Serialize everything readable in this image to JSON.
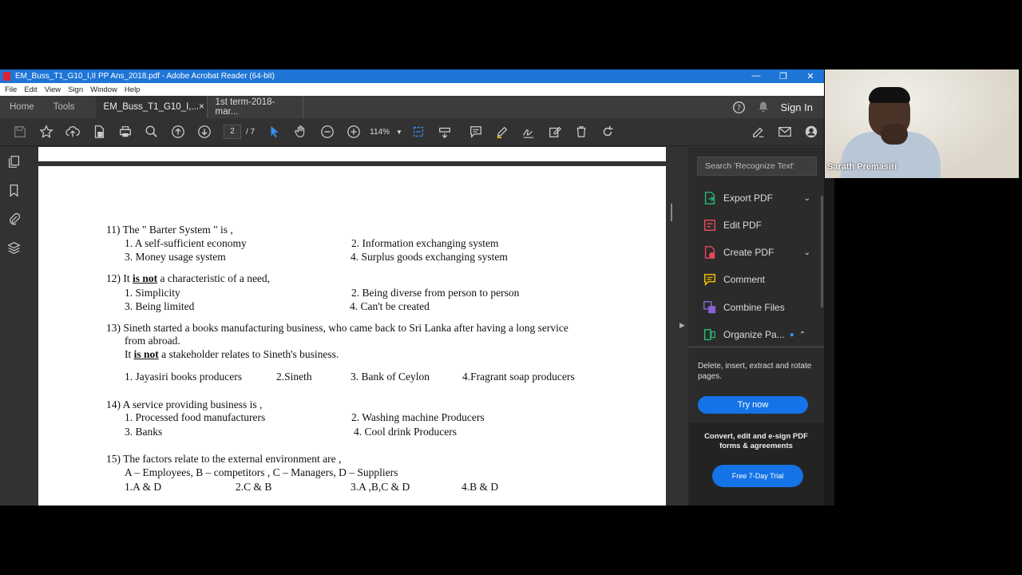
{
  "window": {
    "title": "EM_Buss_T1_G10_I,II PP  Ans_2018.pdf - Adobe Acrobat Reader (64-bit)",
    "min": "—",
    "max": "❐",
    "close": "✕"
  },
  "menu": [
    "File",
    "Edit",
    "View",
    "Sign",
    "Window",
    "Help"
  ],
  "tabs": {
    "home": "Home",
    "tools": "Tools",
    "doc1": "EM_Buss_T1_G10_I,...",
    "doc1_close": "×",
    "doc2": "1st term-2018-mar...",
    "signin": "Sign In"
  },
  "toolbar": {
    "page_current": "2",
    "page_total": "/ 7",
    "zoom": "114%"
  },
  "right_panel": {
    "search_placeholder": "Search 'Recognize Text'",
    "items": [
      {
        "label": "Export PDF",
        "color": "#2bb673"
      },
      {
        "label": "Edit PDF",
        "color": "#e8485c"
      },
      {
        "label": "Create PDF",
        "color": "#e8485c"
      },
      {
        "label": "Comment",
        "color": "#f5c400"
      },
      {
        "label": "Combine Files",
        "color": "#8a63d2"
      },
      {
        "label": "Organize Pa...",
        "color": "#2bb673"
      }
    ],
    "description": "Delete, insert, extract and rotate pages.",
    "try_now": "Try now",
    "promo_text": "Convert, edit and e-sign PDF forms & agreements",
    "trial_button": "Free 7-Day Trial"
  },
  "video": {
    "participant": "Sarath Premasiri"
  },
  "document": {
    "q11": {
      "stem": "11) The \" Barter System \"  is ,",
      "o1": "1.  A self-sufficient economy",
      "o2": "2.  Information exchanging system",
      "o3": "3.  Money usage system",
      "o4": "4.  Surplus goods exchanging system"
    },
    "q12": {
      "pre": "12) It ",
      "neg": "is not",
      "post": " a characteristic of a need,",
      "o1": "1.  Simplicity",
      "o2": "2.  Being diverse from person to person",
      "o3": "3.  Being limited",
      "o4": "4.  Can't be created"
    },
    "q13": {
      "line1": "13) Sineth started a books manufacturing business, who came back to Sri Lanka after having a long service",
      "line2": "from abroad.",
      "pre": "It ",
      "neg": "is not",
      "post": " a stakeholder relates to Sineth's business.",
      "o1": "1. Jayasiri books producers",
      "o2": "2.Sineth",
      "o3": "3.  Bank of Ceylon",
      "o4": "4.Fragrant soap producers"
    },
    "q14": {
      "stem": "14) A service providing business is ,",
      "o1": "1. Processed food manufacturers",
      "o2": "2. Washing machine Producers",
      "o3": "3. Banks",
      "o4": "4. Cool drink Producers"
    },
    "q15": {
      "stem": "15)  The factors relate to the external environment are ,",
      "line2": "A – Employees, B – competitors   , C – Managers, D – Suppliers",
      "o1": "1.A & D",
      "o2": "2.C & B",
      "o3": "3.A ,B,C & D",
      "o4": "4.B & D"
    }
  }
}
